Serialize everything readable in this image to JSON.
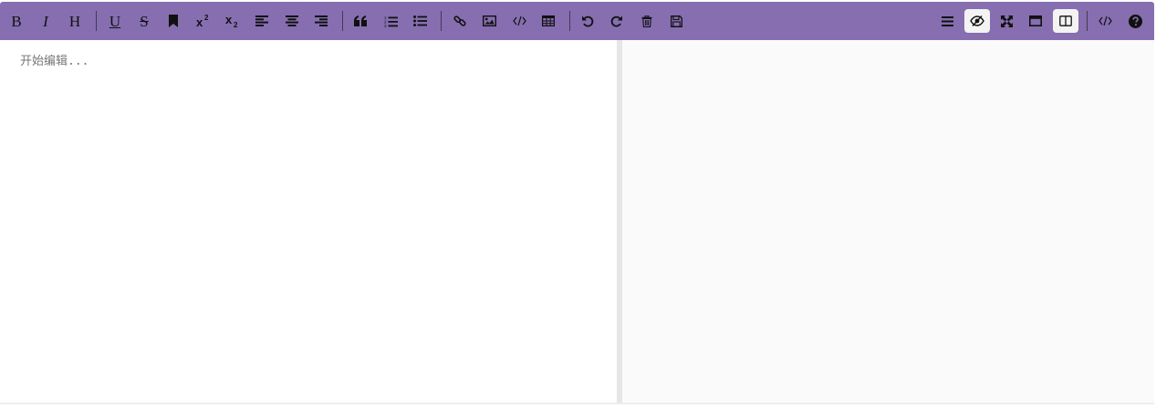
{
  "theme": {
    "toolbar_color": "#866eb0",
    "preview_bg": "#fafafa",
    "divider_color": "#e6e6e6"
  },
  "toolbar": {
    "bold_label": "B",
    "italic_label": "I",
    "header_label": "H",
    "underline_label": "U",
    "strikethrough_label": "S",
    "icons_left": [
      "bold",
      "italic",
      "header",
      "underline",
      "strikethrough",
      "mark-icon",
      "superscript",
      "subscript",
      "align-left-icon",
      "align-center-icon",
      "align-right-icon",
      "quote-icon",
      "ordered-list-icon",
      "unordered-list-icon",
      "link-icon",
      "image-icon",
      "code-icon",
      "table-icon",
      "undo-icon",
      "redo-icon",
      "trash-icon",
      "save-icon"
    ],
    "icons_right": [
      "navigation-icon",
      "preview-icon",
      "fullscreen-icon",
      "read-mode-icon",
      "subfield-icon",
      "html-code-icon",
      "help-icon"
    ],
    "active_right": [
      "preview-icon",
      "subfield-icon"
    ]
  },
  "editor": {
    "placeholder": "开始编辑...",
    "value": ""
  }
}
